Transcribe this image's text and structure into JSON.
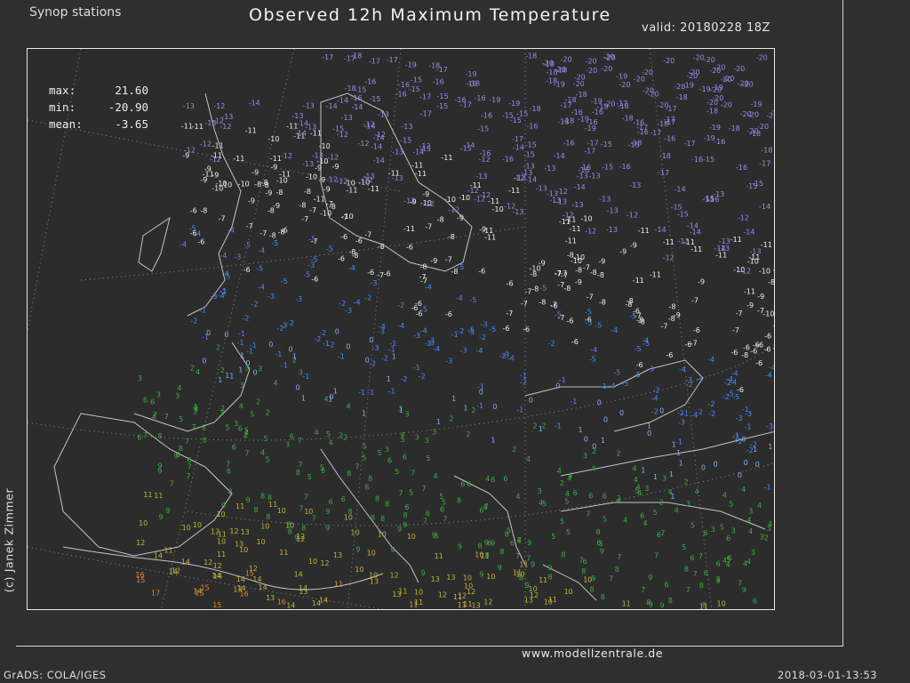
{
  "header": {
    "subtitle": "Synop stations",
    "title": "Observed 12h Maximum Temperature",
    "valid": "valid: 20180228 18Z"
  },
  "stats": {
    "max_label": "max:",
    "max_value": "21.60",
    "min_label": "min:",
    "min_value": "-20.90",
    "mean_label": "mean:",
    "mean_value": "-3.65"
  },
  "credit": "(c) Janek Zimmer",
  "website": "www.modellzentrale.de",
  "footer": {
    "left": "GrADS: COLA/IGES",
    "right": "2018-03-01-13:53"
  },
  "colors": {
    "coast": "#bdbdbd",
    "grid": "#9a9a9a",
    "very_cold": "#9b8cf0",
    "cold": "#4a8cff",
    "cool": "#7fb2ff",
    "mild": "#3cb043",
    "warm": "#c7b43a",
    "hot": "#e8862a",
    "white": "#f0f0f0"
  }
}
